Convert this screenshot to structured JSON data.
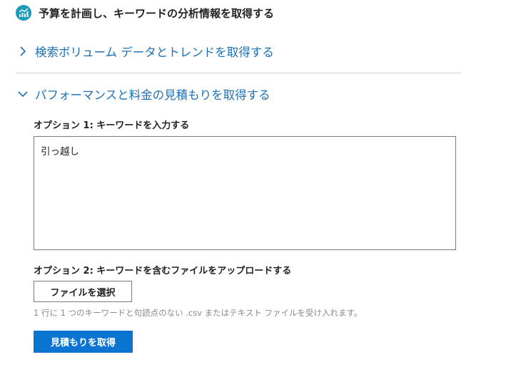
{
  "header": {
    "icon": "chart-trend-icon",
    "accent_color": "#1a9bb7",
    "title": "予算を計画し、キーワードの分析情報を取得する"
  },
  "sections": [
    {
      "label": "検索ボリューム データとトレンドを取得する",
      "expanded": false,
      "icon": "chevron-right-icon"
    },
    {
      "label": "パフォーマンスと料金の見積もりを取得する",
      "expanded": true,
      "icon": "chevron-down-icon"
    }
  ],
  "form": {
    "option1_label": "オプション 1: キーワードを入力する",
    "keywords_value": "引っ越し",
    "option2_label": "オプション 2: キーワードを含むファイルをアップロードする",
    "file_button_label": "ファイルを選択",
    "hint": "1 行に 1 つのキーワードと句読点のない .csv またはテキスト ファイルを受け入れます。",
    "submit_label": "見積もりを取得"
  },
  "colors": {
    "link": "#1f6fb5",
    "primary_button": "#0b74d1"
  }
}
